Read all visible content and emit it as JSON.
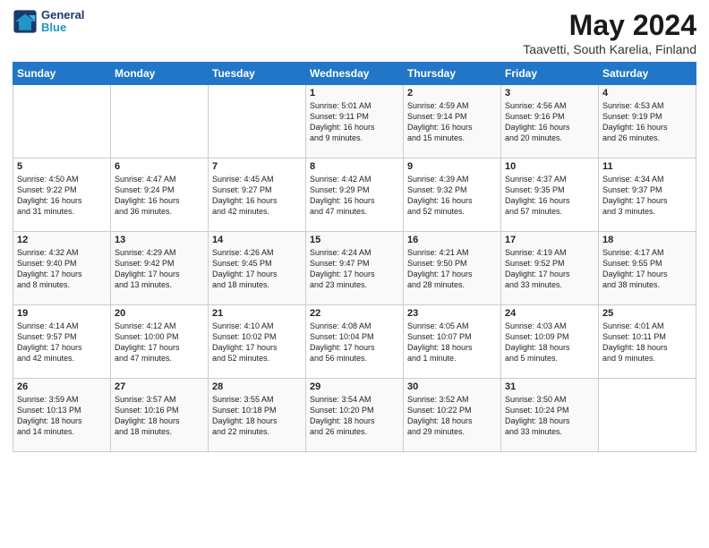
{
  "header": {
    "logo_line1": "General",
    "logo_line2": "Blue",
    "title": "May 2024",
    "subtitle": "Taavetti, South Karelia, Finland"
  },
  "weekdays": [
    "Sunday",
    "Monday",
    "Tuesday",
    "Wednesday",
    "Thursday",
    "Friday",
    "Saturday"
  ],
  "weeks": [
    [
      {
        "day": "",
        "info": ""
      },
      {
        "day": "",
        "info": ""
      },
      {
        "day": "",
        "info": ""
      },
      {
        "day": "1",
        "info": "Sunrise: 5:01 AM\nSunset: 9:11 PM\nDaylight: 16 hours\nand 9 minutes."
      },
      {
        "day": "2",
        "info": "Sunrise: 4:59 AM\nSunset: 9:14 PM\nDaylight: 16 hours\nand 15 minutes."
      },
      {
        "day": "3",
        "info": "Sunrise: 4:56 AM\nSunset: 9:16 PM\nDaylight: 16 hours\nand 20 minutes."
      },
      {
        "day": "4",
        "info": "Sunrise: 4:53 AM\nSunset: 9:19 PM\nDaylight: 16 hours\nand 26 minutes."
      }
    ],
    [
      {
        "day": "5",
        "info": "Sunrise: 4:50 AM\nSunset: 9:22 PM\nDaylight: 16 hours\nand 31 minutes."
      },
      {
        "day": "6",
        "info": "Sunrise: 4:47 AM\nSunset: 9:24 PM\nDaylight: 16 hours\nand 36 minutes."
      },
      {
        "day": "7",
        "info": "Sunrise: 4:45 AM\nSunset: 9:27 PM\nDaylight: 16 hours\nand 42 minutes."
      },
      {
        "day": "8",
        "info": "Sunrise: 4:42 AM\nSunset: 9:29 PM\nDaylight: 16 hours\nand 47 minutes."
      },
      {
        "day": "9",
        "info": "Sunrise: 4:39 AM\nSunset: 9:32 PM\nDaylight: 16 hours\nand 52 minutes."
      },
      {
        "day": "10",
        "info": "Sunrise: 4:37 AM\nSunset: 9:35 PM\nDaylight: 16 hours\nand 57 minutes."
      },
      {
        "day": "11",
        "info": "Sunrise: 4:34 AM\nSunset: 9:37 PM\nDaylight: 17 hours\nand 3 minutes."
      }
    ],
    [
      {
        "day": "12",
        "info": "Sunrise: 4:32 AM\nSunset: 9:40 PM\nDaylight: 17 hours\nand 8 minutes."
      },
      {
        "day": "13",
        "info": "Sunrise: 4:29 AM\nSunset: 9:42 PM\nDaylight: 17 hours\nand 13 minutes."
      },
      {
        "day": "14",
        "info": "Sunrise: 4:26 AM\nSunset: 9:45 PM\nDaylight: 17 hours\nand 18 minutes."
      },
      {
        "day": "15",
        "info": "Sunrise: 4:24 AM\nSunset: 9:47 PM\nDaylight: 17 hours\nand 23 minutes."
      },
      {
        "day": "16",
        "info": "Sunrise: 4:21 AM\nSunset: 9:50 PM\nDaylight: 17 hours\nand 28 minutes."
      },
      {
        "day": "17",
        "info": "Sunrise: 4:19 AM\nSunset: 9:52 PM\nDaylight: 17 hours\nand 33 minutes."
      },
      {
        "day": "18",
        "info": "Sunrise: 4:17 AM\nSunset: 9:55 PM\nDaylight: 17 hours\nand 38 minutes."
      }
    ],
    [
      {
        "day": "19",
        "info": "Sunrise: 4:14 AM\nSunset: 9:57 PM\nDaylight: 17 hours\nand 42 minutes."
      },
      {
        "day": "20",
        "info": "Sunrise: 4:12 AM\nSunset: 10:00 PM\nDaylight: 17 hours\nand 47 minutes."
      },
      {
        "day": "21",
        "info": "Sunrise: 4:10 AM\nSunset: 10:02 PM\nDaylight: 17 hours\nand 52 minutes."
      },
      {
        "day": "22",
        "info": "Sunrise: 4:08 AM\nSunset: 10:04 PM\nDaylight: 17 hours\nand 56 minutes."
      },
      {
        "day": "23",
        "info": "Sunrise: 4:05 AM\nSunset: 10:07 PM\nDaylight: 18 hours\nand 1 minute."
      },
      {
        "day": "24",
        "info": "Sunrise: 4:03 AM\nSunset: 10:09 PM\nDaylight: 18 hours\nand 5 minutes."
      },
      {
        "day": "25",
        "info": "Sunrise: 4:01 AM\nSunset: 10:11 PM\nDaylight: 18 hours\nand 9 minutes."
      }
    ],
    [
      {
        "day": "26",
        "info": "Sunrise: 3:59 AM\nSunset: 10:13 PM\nDaylight: 18 hours\nand 14 minutes."
      },
      {
        "day": "27",
        "info": "Sunrise: 3:57 AM\nSunset: 10:16 PM\nDaylight: 18 hours\nand 18 minutes."
      },
      {
        "day": "28",
        "info": "Sunrise: 3:55 AM\nSunset: 10:18 PM\nDaylight: 18 hours\nand 22 minutes."
      },
      {
        "day": "29",
        "info": "Sunrise: 3:54 AM\nSunset: 10:20 PM\nDaylight: 18 hours\nand 26 minutes."
      },
      {
        "day": "30",
        "info": "Sunrise: 3:52 AM\nSunset: 10:22 PM\nDaylight: 18 hours\nand 29 minutes."
      },
      {
        "day": "31",
        "info": "Sunrise: 3:50 AM\nSunset: 10:24 PM\nDaylight: 18 hours\nand 33 minutes."
      },
      {
        "day": "",
        "info": ""
      }
    ]
  ]
}
